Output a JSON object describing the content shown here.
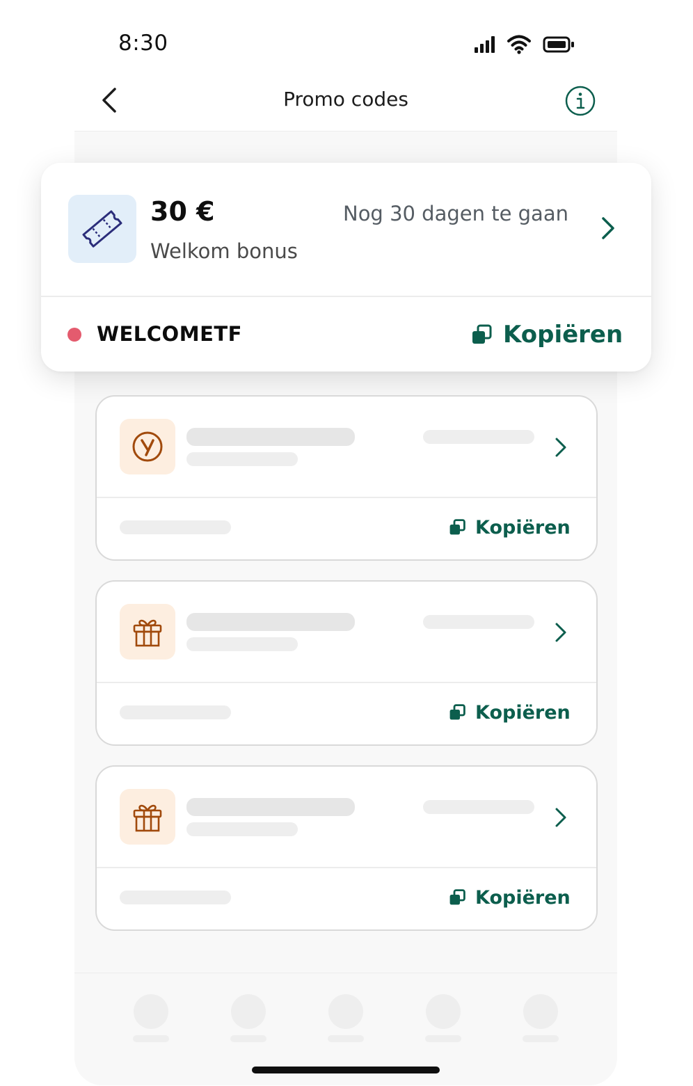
{
  "status_bar": {
    "time": "8:30"
  },
  "nav": {
    "title": "Promo codes"
  },
  "featured_promo": {
    "amount": "30 €",
    "name": "Welkom bonus",
    "expiry": "Nog 30 dagen te gaan",
    "code": "WELCOMETF",
    "copy_label": "Kopiëren",
    "icon": "ticket-icon",
    "status_color": "#e45b6e"
  },
  "placeholder_promos": [
    {
      "icon": "yoyo-brand-icon",
      "copy_label": "Kopiëren"
    },
    {
      "icon": "gift-icon",
      "copy_label": "Kopiëren"
    },
    {
      "icon": "gift-icon",
      "copy_label": "Kopiëren"
    }
  ],
  "colors": {
    "accent": "#0c5e4d",
    "icon_orange": "#a14a0c",
    "ticket_icon": "#2b2d7a"
  }
}
